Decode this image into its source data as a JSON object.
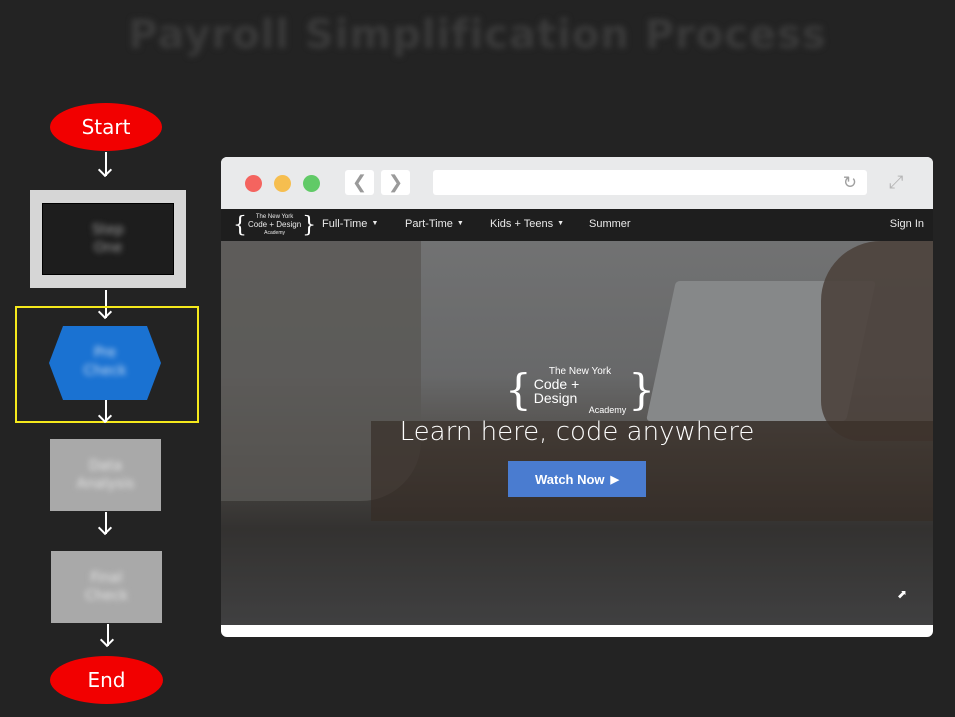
{
  "title": "Payroll Simplification Process",
  "flowchart": {
    "start_label": "Start",
    "end_label": "End",
    "step1_text": [
      "Step",
      "One"
    ],
    "step2_text": [
      "Pre",
      "Check"
    ],
    "step3_text": [
      "Data",
      "Analysis"
    ],
    "step4_text": [
      "Final",
      "Check"
    ],
    "colors": {
      "terminal": "#f20000",
      "decision": "#1a72d2",
      "highlight": "#f5e91c",
      "process": "#a9a9a9"
    }
  },
  "browser": {
    "nav_back_icon": "chevron-left-icon",
    "nav_forward_icon": "chevron-right-icon",
    "reload_icon": "reload-icon",
    "expand_icon": "expand-icon",
    "site": {
      "logo_line1": "The New York",
      "logo_line2": "Code + Design",
      "logo_line3": "Academy",
      "nav": [
        "Full-Time",
        "Part-Time",
        "Kids + Teens",
        "Summer"
      ],
      "sign_in": "Sign In",
      "headline": "Learn here, code anywhere",
      "cta_label": "Watch Now",
      "cta_color": "#4a7cd0"
    }
  }
}
